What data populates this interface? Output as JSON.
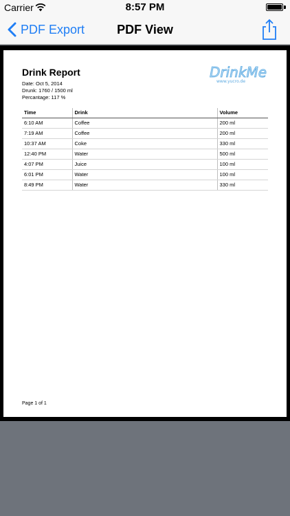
{
  "status_bar": {
    "carrier": "Carrier",
    "time": "8:57 PM"
  },
  "nav": {
    "back_label": "PDF Export",
    "title": "PDF View"
  },
  "report": {
    "title": "Drink Report",
    "date": "Date: Oct 5, 2014",
    "drunk": "Drunk: 1760 / 1500 ml",
    "percentage": "Percantage: 117 %",
    "logo_text": "DrinkMe",
    "logo_url": "www.yucro.de",
    "columns": [
      "Time",
      "Drink",
      "Volume"
    ],
    "rows": [
      {
        "time": "6:10 AM",
        "drink": "Coffee",
        "volume": "200 ml"
      },
      {
        "time": "7:19 AM",
        "drink": "Coffee",
        "volume": "200 ml"
      },
      {
        "time": "10:37 AM",
        "drink": "Coke",
        "volume": "330 ml"
      },
      {
        "time": "12:40 PM",
        "drink": "Water",
        "volume": "500 ml"
      },
      {
        "time": "4:07 PM",
        "drink": "Juice",
        "volume": "100 ml"
      },
      {
        "time": "6:01 PM",
        "drink": "Water",
        "volume": "100 ml"
      },
      {
        "time": "8:49 PM",
        "drink": "Water",
        "volume": "330 ml"
      }
    ],
    "footer": "Page 1 of 1"
  },
  "colors": {
    "accent": "#1f7ef5",
    "viewer_bg": "#000000",
    "below_bg": "#6e737b"
  },
  "icons": {
    "back": "chevron-left-icon",
    "share": "share-icon",
    "wifi": "wifi-icon",
    "battery": "battery-icon"
  }
}
